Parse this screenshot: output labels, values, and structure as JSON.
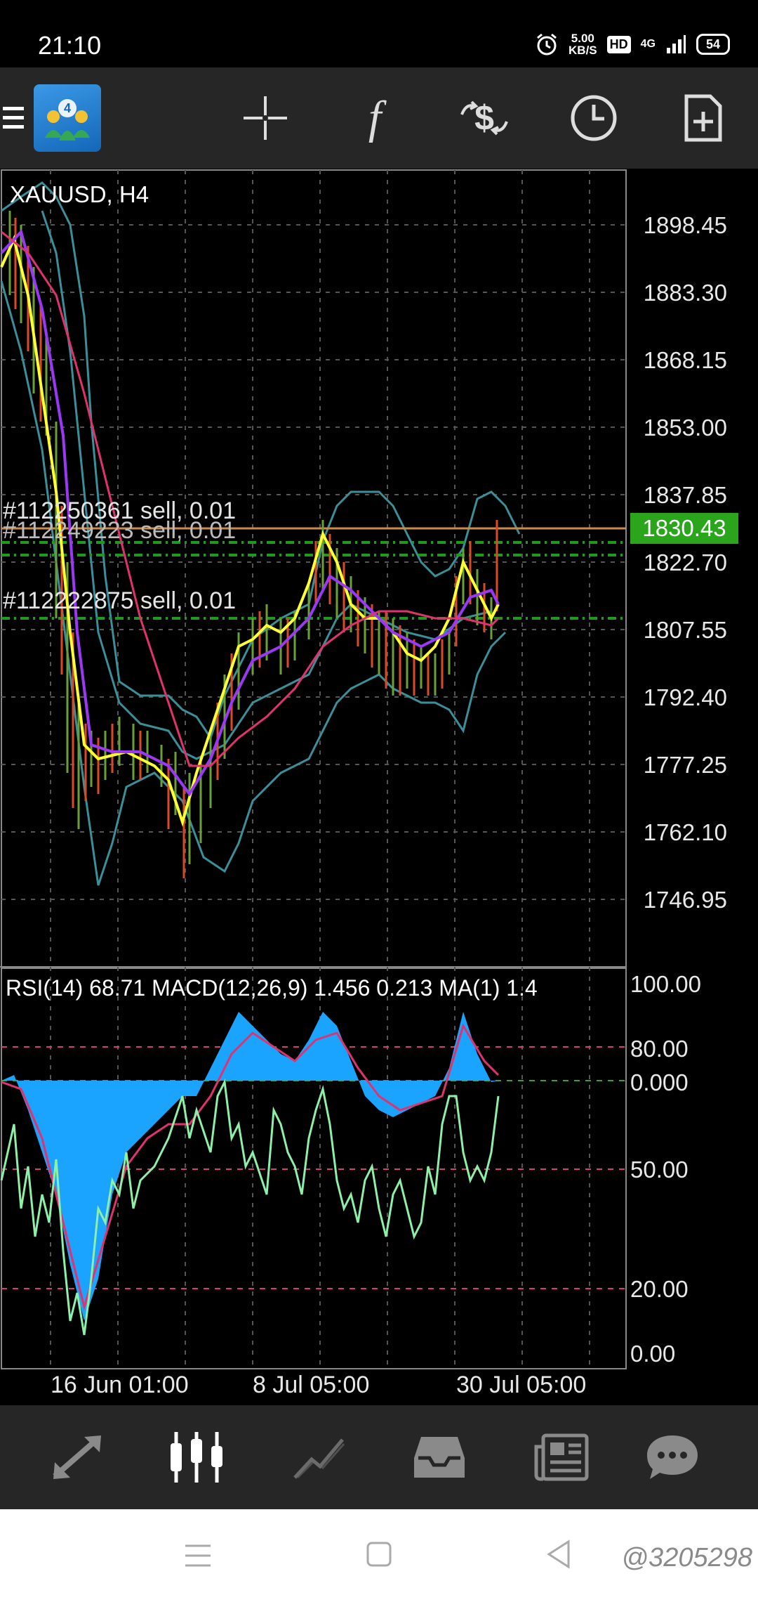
{
  "status": {
    "time": "21:10",
    "speed_value": "5.00",
    "speed_unit": "KB/S",
    "hd": "HD",
    "network": "4G",
    "battery": "54"
  },
  "toolbar": {
    "menu_icon": "hamburger-icon",
    "logo": "metatrader-4-logo",
    "items": [
      "crosshair-icon",
      "indicators-f-icon",
      "trade-dollar-icon",
      "clock-icon",
      "new-document-icon"
    ]
  },
  "chart": {
    "title": "XAUUSD, H4",
    "price_scale": [
      "1898.45",
      "1883.30",
      "1868.15",
      "1853.00",
      "1837.85",
      "1822.70",
      "1807.55",
      "1792.40",
      "1777.25",
      "1762.10",
      "1746.95"
    ],
    "current_price": "1830.43",
    "orders": [
      "#112250361 sell, 0.01",
      "#112249223 sell, 0.01",
      "#112222875 sell, 0.01"
    ],
    "colors": {
      "current_price_bg": "#2aa51c",
      "order_line": "#c98a4a",
      "green_line": "#1f9a1f",
      "grid": "#555555",
      "bollinger": "#3a8f98",
      "ma_yellow": "#ffff33",
      "ma_purple": "#9b38f5",
      "ma_red": "#e0336e",
      "candle_green": "#6a9f3a",
      "candle_red": "#d84a28",
      "macd_fill": "#1aa3ff",
      "rsi_line": "#8ef0a8",
      "level_line": "#d6406c"
    }
  },
  "indicator": {
    "title": "RSI(14) 68.71 MACD(12,26,9) 1.456 0.213 MA(1) 1.4",
    "scale": [
      "100.00",
      "80.00",
      "0.000",
      "50.00",
      "20.00",
      "0.00"
    ]
  },
  "time_axis": [
    "16 Jun 01:00",
    "8 Jul 05:00",
    "30 Jul 05:00"
  ],
  "bottom_nav": [
    "quotes-arrows-icon",
    "chart-candles-icon",
    "trade-line-icon",
    "inbox-icon",
    "news-icon",
    "chat-icon"
  ],
  "system_nav": [
    "menu-lines-icon",
    "home-square-icon",
    "back-triangle-icon"
  ],
  "watermark": "@3205298"
}
